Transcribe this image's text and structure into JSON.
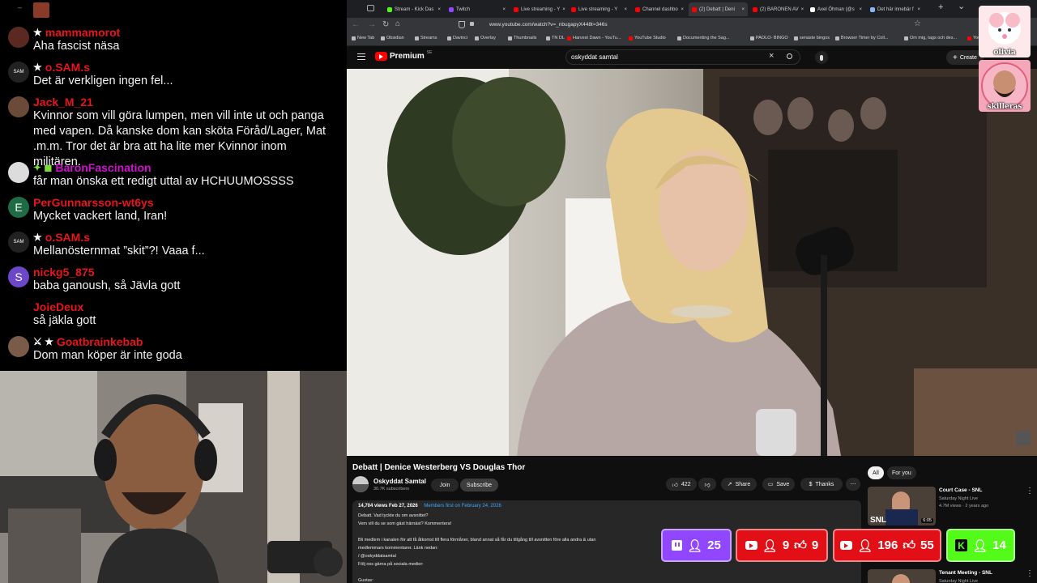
{
  "chat": {
    "messages": [
      {
        "user": "mammamorot",
        "badges": "★",
        "text": "Aha fascist näsa",
        "avatar_color": "#5a2a22",
        "avatar_text": ""
      },
      {
        "user": "o.SAM.s",
        "badges": "★",
        "text": "Det är verkligen ingen fel...",
        "avatar_color": "#222222",
        "avatar_text": "SAM"
      },
      {
        "user": "Jack_M_21",
        "badges": "",
        "text": "Kvinnor som vill göra lumpen, men vill inte ut och panga med vapen. Då kanske dom kan sköta Föråd/Lager, Mat .m.m. Tror det är bra att ha lite mer Kvinnor inom militären.",
        "avatar_color": "#6b4a3a",
        "avatar_text": ""
      },
      {
        "user": "BaronFascination",
        "badges": "✦ ◼",
        "text": "får man önska ett redigt uttal av HCHUUMOSSSS",
        "avatar_color": "#dcdcdc",
        "avatar_text": ""
      },
      {
        "user": "PerGunnarsson-wt6ys",
        "badges": "",
        "text": "Mycket vackert land, Iran!",
        "avatar_color": "#1f6b45",
        "avatar_text": "E"
      },
      {
        "user": "o.SAM.s",
        "badges": "★",
        "text": "Mellanösternmat ”skit”?! Vaaa f...",
        "avatar_color": "#222222",
        "avatar_text": "SAM"
      },
      {
        "user": "nickg5_875",
        "badges": "",
        "text": "baba ganoush, så Jävla gott",
        "avatar_color": "#6c48c8",
        "avatar_text": "S"
      },
      {
        "user": "JoieDeux",
        "badges": "",
        "text": "så jäkla gott",
        "avatar_color": "",
        "avatar_text": ""
      },
      {
        "user": "Goatbrainkebab",
        "badges": "⚔ ★",
        "text": "Dom man köper är inte goda",
        "avatar_color": "#7a5a48",
        "avatar_text": ""
      }
    ]
  },
  "browser": {
    "tabs": [
      {
        "label": "Stream - Kick Das",
        "color": "#53fc18"
      },
      {
        "label": "Twitch",
        "color": "#9146ff"
      },
      {
        "label": "Live streaming - Y",
        "color": "#ff0000"
      },
      {
        "label": "Live streaming - Y",
        "color": "#ff0000"
      },
      {
        "label": "Channel dashbo",
        "color": "#ff0000"
      },
      {
        "label": "(2) Debatt | Deni",
        "color": "#ff0000"
      },
      {
        "label": "(2) BARONEN AV",
        "color": "#ff0000"
      },
      {
        "label": "Axel Öhman (@s",
        "color": "#ffffff"
      },
      {
        "label": "Det här innebär f",
        "color": "#8ab4f8"
      }
    ],
    "url": "www.youtube.com/watch?v=_nbugapyX448t=346s",
    "bookmarks": [
      "New Tab",
      "Obsidian",
      "Streams",
      "Davinci",
      "Overlay",
      "Thumbnails",
      "TN DL",
      "Harvest Dawn - YouTu...",
      "YouTube Studio",
      "Documenting the Sag...",
      "PAOLO- BINGO",
      "senaste bingos",
      "Browser Timer by Coll...",
      "Om mig, tags och des...",
      "You"
    ]
  },
  "youtube": {
    "logo": "Premium",
    "logo_suffix": "SE",
    "search_value": "oskyddat samtal",
    "create_label": "Create",
    "video_title": "Debatt | Denice Westerberg VS Douglas Thor",
    "channel_name": "Oskyddat Samtal",
    "subscribers": "30.7K subscribers",
    "join_label": "Join",
    "subscribe_label": "Subscribe",
    "likes": "422",
    "share_label": "Share",
    "save_label": "Save",
    "thanks_label": "Thanks",
    "views": "14,704 views  Feb 27, 2026",
    "members_first": "Members first on February 24, 2026",
    "description_lines": [
      "Debatt. Vad tyckte du om avsnittet?",
      "Vem vill du se som gäst härnäst? Kommentera!",
      "",
      "Bli medlem i kanalen för att få åtkomst till flera förmåner, bland annat så får du tillgång till avsnitten före alla andra & utan",
      "medlemmars kommentarer. Länk nedan:",
      " / @oskyddatsamtal",
      "Följ oss gärna på sociala medier:",
      "",
      "Gustav:"
    ],
    "filter_chips": [
      "All",
      "For you"
    ],
    "related": [
      {
        "title": "Court Case - SNL",
        "channel": "Saturday Night Live",
        "meta": "4.7M views · 2 years ago",
        "duration": "6:05"
      },
      {
        "title": "Tenant Meeting - SNL",
        "channel": "Saturday Night Live",
        "meta": "",
        "duration": ""
      }
    ]
  },
  "overlays": {
    "twitch_viewers": "25",
    "yt1_viewers": "9",
    "yt1_likes": "9",
    "yt2_viewers": "196",
    "yt2_likes": "55",
    "kick_viewers": "14",
    "corner1_label": "olivia",
    "corner2_label": "skilleras"
  }
}
